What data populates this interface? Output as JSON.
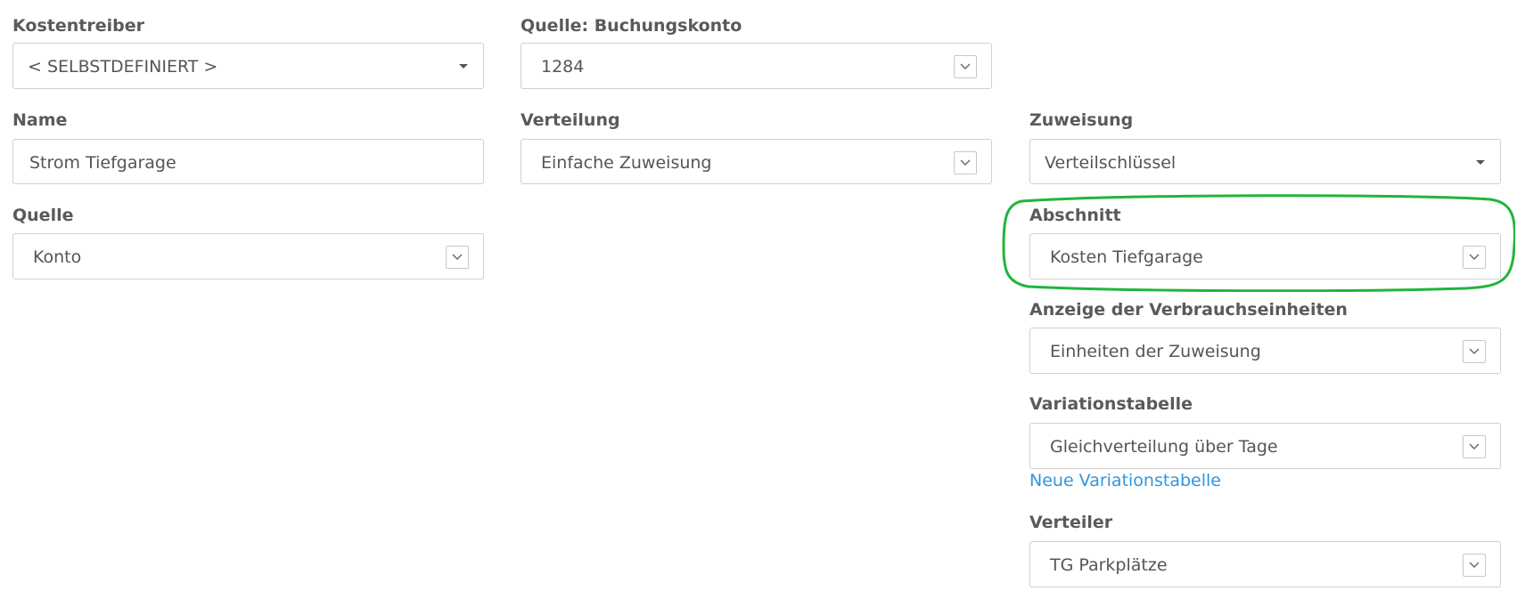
{
  "form": {
    "kostentreiber": {
      "label": "Kostentreiber",
      "value": "< SELBSTDEFINIERT >"
    },
    "quelle_buchungskonto": {
      "label": "Quelle: Buchungskonto",
      "value": "1284"
    },
    "name": {
      "label": "Name",
      "value": "Strom Tiefgarage"
    },
    "verteilung": {
      "label": "Verteilung",
      "value": "Einfache Zuweisung"
    },
    "zuweisung": {
      "label": "Zuweisung",
      "value": "Verteilschlüssel"
    },
    "quelle": {
      "label": "Quelle",
      "value": "Konto"
    },
    "abschnitt": {
      "label": "Abschnitt",
      "value": "Kosten Tiefgarage"
    },
    "anzeige_verbrauchseinheiten": {
      "label": "Anzeige der Verbrauchseinheiten",
      "value": "Einheiten der Zuweisung"
    },
    "variationstabelle": {
      "label": "Variationstabelle",
      "value": "Gleichverteilung über Tage",
      "link": "Neue Variationstabelle"
    },
    "verteiler": {
      "label": "Verteiler",
      "value": "TG Parkplätze"
    }
  },
  "colors": {
    "link": "#2f96e0",
    "highlight": "#22b53a",
    "label": "#5a5a5a",
    "border": "#cfcfcf"
  },
  "icons": {
    "dropdown_caret": "caret-down-icon",
    "select_chevron": "chevron-down-icon"
  }
}
